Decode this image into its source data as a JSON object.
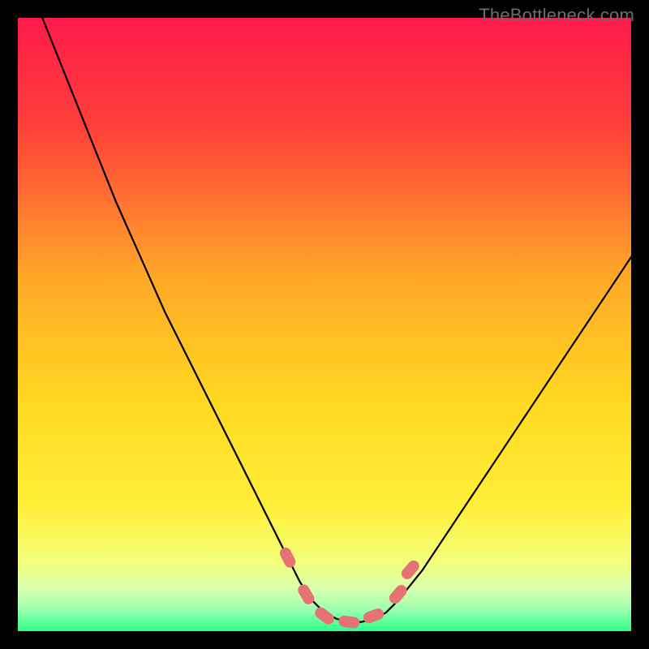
{
  "watermark": "TheBottleneck.com",
  "colors": {
    "top": "#ff1a4b",
    "mid_upper": "#ff7a2a",
    "mid": "#ffe600",
    "mid_lower": "#f6ff66",
    "low_band": "#dfffb0",
    "bottom": "#2cff88",
    "curve": "#000000",
    "marker": "#e57373",
    "frame": "#000000"
  },
  "chart_data": {
    "type": "line",
    "title": "",
    "xlabel": "",
    "ylabel": "",
    "xlim": [
      0,
      100
    ],
    "ylim": [
      0,
      100
    ],
    "series": [
      {
        "name": "bottleneck-curve",
        "x": [
          4,
          8,
          12,
          16,
          20,
          24,
          28,
          32,
          36,
          40,
          42,
          44,
          46,
          48,
          50,
          52,
          54,
          56,
          58,
          60,
          62,
          66,
          72,
          78,
          84,
          90,
          96,
          100
        ],
        "y": [
          100,
          90,
          80,
          70,
          61,
          52,
          44,
          36,
          28,
          20,
          16,
          12,
          8,
          5,
          3,
          2,
          1.5,
          1.5,
          2,
          3,
          5,
          10,
          19,
          28,
          37,
          46,
          55,
          61
        ]
      }
    ],
    "markers": [
      {
        "name": "left-threshold-upper",
        "x": 44,
        "y": 12
      },
      {
        "name": "left-threshold-lower",
        "x": 47,
        "y": 6
      },
      {
        "name": "valley-left",
        "x": 50,
        "y": 2.5
      },
      {
        "name": "valley-center",
        "x": 54,
        "y": 1.5
      },
      {
        "name": "valley-right",
        "x": 58,
        "y": 2.5
      },
      {
        "name": "right-threshold-lower",
        "x": 62,
        "y": 6
      },
      {
        "name": "right-threshold-upper",
        "x": 64,
        "y": 10
      }
    ]
  }
}
